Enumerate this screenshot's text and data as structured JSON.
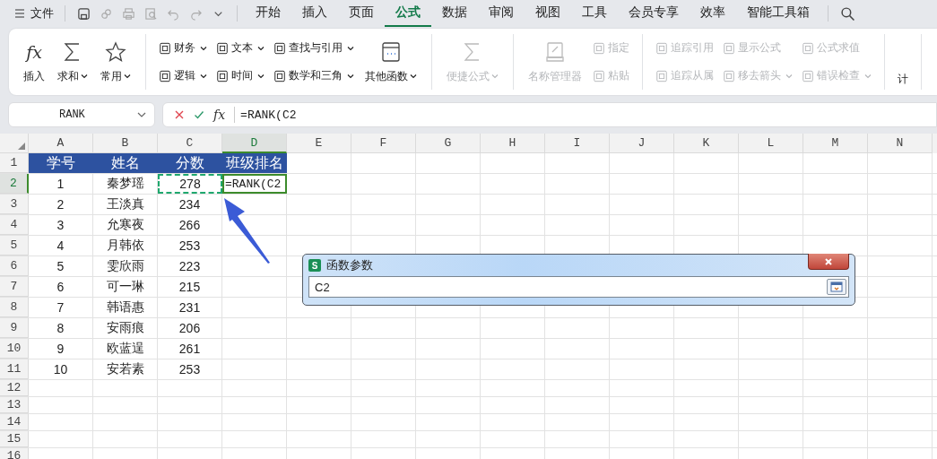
{
  "menu_bar": {
    "file_menu": "文件",
    "tabs": [
      {
        "label": "开始",
        "selected": false
      },
      {
        "label": "插入",
        "selected": false
      },
      {
        "label": "页面",
        "selected": false
      },
      {
        "label": "公式",
        "selected": true
      },
      {
        "label": "数据",
        "selected": false
      },
      {
        "label": "审阅",
        "selected": false
      },
      {
        "label": "视图",
        "selected": false
      },
      {
        "label": "工具",
        "selected": false
      },
      {
        "label": "会员专享",
        "selected": false
      },
      {
        "label": "效率",
        "selected": false
      },
      {
        "label": "智能工具箱",
        "selected": false
      }
    ]
  },
  "ribbon": {
    "groups": [
      {
        "columns": [
          [
            {
              "kind": "large",
              "label": "插入",
              "symbol": "fx",
              "dropdown": false,
              "disabled": false
            }
          ],
          [
            {
              "kind": "large",
              "label": "求和",
              "dropdown": true,
              "disabled": false
            }
          ],
          [
            {
              "kind": "large",
              "label": "常用",
              "dropdown": true,
              "disabled": false
            }
          ]
        ]
      },
      {
        "columns": [
          [
            {
              "kind": "small",
              "label": "财务",
              "dropdown": true,
              "disabled": false
            },
            {
              "kind": "small",
              "label": "逻辑",
              "dropdown": true,
              "disabled": false
            }
          ],
          [
            {
              "kind": "small",
              "label": "文本",
              "dropdown": true,
              "disabled": false
            },
            {
              "kind": "small",
              "label": "时间",
              "dropdown": true,
              "disabled": false
            }
          ],
          [
            {
              "kind": "small",
              "label": "查找与引用",
              "dropdown": true,
              "disabled": false
            },
            {
              "kind": "small",
              "label": "数学和三角",
              "dropdown": true,
              "disabled": false
            }
          ],
          [
            {
              "kind": "large",
              "label": "其他函数",
              "dropdown": true,
              "disabled": false
            }
          ]
        ]
      },
      {
        "columns": [
          [
            {
              "kind": "large",
              "label": "便捷公式",
              "dropdown": true,
              "disabled": true
            }
          ]
        ]
      },
      {
        "columns": [
          [
            {
              "kind": "large",
              "label": "名称管理器",
              "dropdown": false,
              "disabled": true
            }
          ],
          [
            {
              "kind": "small",
              "label": "指定",
              "dropdown": false,
              "disabled": true
            },
            {
              "kind": "small",
              "label": "粘贴",
              "dropdown": false,
              "disabled": true
            }
          ]
        ]
      },
      {
        "columns": [
          [
            {
              "kind": "small",
              "label": "追踪引用",
              "dropdown": false,
              "disabled": true
            },
            {
              "kind": "small",
              "label": "追踪从属",
              "dropdown": false,
              "disabled": true
            }
          ],
          [
            {
              "kind": "small",
              "label": "显示公式",
              "dropdown": false,
              "disabled": true
            },
            {
              "kind": "small",
              "label": "移去箭头",
              "dropdown": true,
              "disabled": true
            }
          ],
          [
            {
              "kind": "small",
              "label": "公式求值",
              "dropdown": false,
              "disabled": true
            },
            {
              "kind": "small",
              "label": "错误检查",
              "dropdown": true,
              "disabled": true
            }
          ]
        ]
      },
      {
        "columns": [
          [
            {
              "kind": "text",
              "label": "计",
              "dropdown": false,
              "disabled": false
            }
          ]
        ]
      }
    ]
  },
  "formula_bar": {
    "name_box": "RANK",
    "function_symbol": "fx",
    "formula": "=RANK(C2"
  },
  "sheet": {
    "columns": [
      {
        "label": "A",
        "selected": false
      },
      {
        "label": "B",
        "selected": false
      },
      {
        "label": "C",
        "selected": false
      },
      {
        "label": "D",
        "selected": true
      },
      {
        "label": "E",
        "selected": false
      },
      {
        "label": "F",
        "selected": false
      },
      {
        "label": "G",
        "selected": false
      },
      {
        "label": "H",
        "selected": false
      },
      {
        "label": "I",
        "selected": false
      },
      {
        "label": "J",
        "selected": false
      },
      {
        "label": "K",
        "selected": false
      },
      {
        "label": "L",
        "selected": false
      },
      {
        "label": "M",
        "selected": false
      },
      {
        "label": "N",
        "selected": false
      }
    ],
    "rows": [
      {
        "number": "1",
        "selected": false,
        "kind": "header",
        "cells": [
          {
            "text": "学号",
            "active": false,
            "referenced": false
          },
          {
            "text": "姓名",
            "active": false,
            "referenced": false
          },
          {
            "text": "分数",
            "active": false,
            "referenced": false
          },
          {
            "text": "班级排名",
            "active": false,
            "referenced": false
          }
        ]
      },
      {
        "number": "2",
        "selected": true,
        "kind": "data",
        "cells": [
          {
            "text": "1",
            "active": false,
            "referenced": false
          },
          {
            "text": "秦梦瑶",
            "active": false,
            "referenced": false
          },
          {
            "text": "278",
            "active": false,
            "referenced": true
          },
          {
            "text": "=RANK(C2",
            "active": true,
            "referenced": false
          }
        ]
      },
      {
        "number": "3",
        "selected": false,
        "kind": "data",
        "cells": [
          {
            "text": "2",
            "active": false,
            "referenced": false
          },
          {
            "text": "王淡真",
            "active": false,
            "referenced": false
          },
          {
            "text": "234",
            "active": false,
            "referenced": false
          }
        ]
      },
      {
        "number": "4",
        "selected": false,
        "kind": "data",
        "cells": [
          {
            "text": "3",
            "active": false,
            "referenced": false
          },
          {
            "text": "允寒夜",
            "active": false,
            "referenced": false
          },
          {
            "text": "266",
            "active": false,
            "referenced": false
          }
        ]
      },
      {
        "number": "5",
        "selected": false,
        "kind": "data",
        "cells": [
          {
            "text": "4",
            "active": false,
            "referenced": false
          },
          {
            "text": "月韩依",
            "active": false,
            "referenced": false
          },
          {
            "text": "253",
            "active": false,
            "referenced": false
          }
        ]
      },
      {
        "number": "6",
        "selected": false,
        "kind": "data",
        "cells": [
          {
            "text": "5",
            "active": false,
            "referenced": false
          },
          {
            "text": "雯欣雨",
            "active": false,
            "referenced": false
          },
          {
            "text": "223",
            "active": false,
            "referenced": false
          }
        ]
      },
      {
        "number": "7",
        "selected": false,
        "kind": "data",
        "cells": [
          {
            "text": "6",
            "active": false,
            "referenced": false
          },
          {
            "text": "可一琳",
            "active": false,
            "referenced": false
          },
          {
            "text": "215",
            "active": false,
            "referenced": false
          }
        ]
      },
      {
        "number": "8",
        "selected": false,
        "kind": "data",
        "cells": [
          {
            "text": "7",
            "active": false,
            "referenced": false
          },
          {
            "text": "韩语惠",
            "active": false,
            "referenced": false
          },
          {
            "text": "231",
            "active": false,
            "referenced": false
          }
        ]
      },
      {
        "number": "9",
        "selected": false,
        "kind": "data",
        "cells": [
          {
            "text": "8",
            "active": false,
            "referenced": false
          },
          {
            "text": "安雨痕",
            "active": false,
            "referenced": false
          },
          {
            "text": "206",
            "active": false,
            "referenced": false
          }
        ]
      },
      {
        "number": "10",
        "selected": false,
        "kind": "data",
        "cells": [
          {
            "text": "9",
            "active": false,
            "referenced": false
          },
          {
            "text": "欧蓝逞",
            "active": false,
            "referenced": false
          },
          {
            "text": "261",
            "active": false,
            "referenced": false
          }
        ]
      },
      {
        "number": "11",
        "selected": false,
        "kind": "data",
        "cells": [
          {
            "text": "10",
            "active": false,
            "referenced": false
          },
          {
            "text": "安若素",
            "active": false,
            "referenced": false
          },
          {
            "text": "253",
            "active": false,
            "referenced": false
          }
        ]
      },
      {
        "number": "12",
        "selected": false,
        "kind": "empty"
      },
      {
        "number": "13",
        "selected": false,
        "kind": "empty"
      },
      {
        "number": "14",
        "selected": false,
        "kind": "empty"
      },
      {
        "number": "15",
        "selected": false,
        "kind": "empty"
      },
      {
        "number": "16",
        "selected": false,
        "kind": "empty"
      }
    ]
  },
  "dialog": {
    "app_badge": "S",
    "title": "函数参数",
    "value": "C2"
  }
}
